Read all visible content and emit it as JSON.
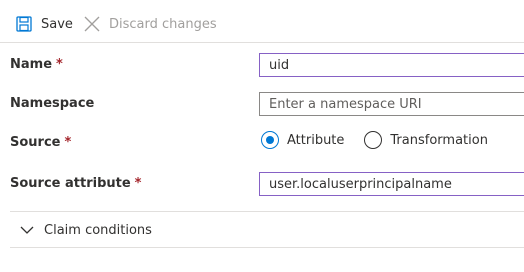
{
  "toolbar": {
    "save_label": "Save",
    "discard_label": "Discard changes",
    "save_icon": "save-icon",
    "discard_icon": "close-icon"
  },
  "form": {
    "name": {
      "label": "Name",
      "required": "*",
      "value": "uid"
    },
    "namespace": {
      "label": "Namespace",
      "placeholder": "Enter a namespace URI",
      "value": ""
    },
    "source": {
      "label": "Source",
      "required": "*",
      "options": [
        "Attribute",
        "Transformation"
      ],
      "selected": "Attribute"
    },
    "source_attribute": {
      "label": "Source attribute",
      "required": "*",
      "value": "user.localuserprincipalname"
    }
  },
  "claim_conditions": {
    "label": "Claim conditions",
    "expanded": false,
    "icon": "chevron-down-icon"
  },
  "colors": {
    "accent": "#0078d4",
    "focus_border": "#8661c5",
    "required": "#a4262c",
    "disabled": "#a19f9d"
  }
}
